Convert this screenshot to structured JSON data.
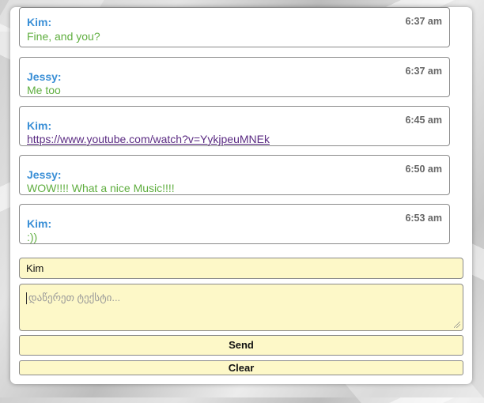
{
  "messages": [
    {
      "name": "Kim:",
      "time": "6:37 am",
      "text": "Fine, and you?",
      "is_link": false
    },
    {
      "name": "Jessy:",
      "time": "6:37 am",
      "text": "Me too",
      "is_link": false
    },
    {
      "name": "Kim:",
      "time": "6:45 am",
      "text": "https://www.youtube.com/watch?v=YykjpeuMNEk",
      "is_link": true
    },
    {
      "name": "Jessy:",
      "time": "6:50 am",
      "text": "WOW!!!! What a nice Music!!!!",
      "is_link": false
    },
    {
      "name": "Kim:",
      "time": "6:53 am",
      "text": ":))",
      "is_link": false
    }
  ],
  "form": {
    "name_value": "Kim",
    "text_placeholder": "დაწერეთ ტექსტი...",
    "send_label": "Send",
    "clear_label": "Clear"
  },
  "colors": {
    "name": "#3a8fd6",
    "message": "#5fae3f",
    "link": "#5a2a82",
    "input_bg": "#fdf8c8"
  }
}
